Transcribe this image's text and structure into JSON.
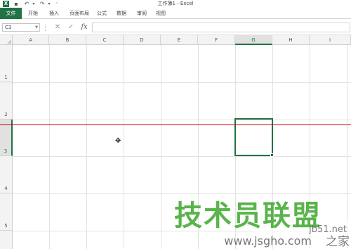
{
  "titlebar": {
    "title": "工作簿1 - Excel",
    "logo_letter": "X",
    "save_icon": "save-icon",
    "undo_icon": "undo-icon",
    "redo_icon": "redo-icon"
  },
  "ribbon": {
    "tabs": [
      "文件",
      "开始",
      "插入",
      "页面布局",
      "公式",
      "数据",
      "审阅",
      "视图"
    ]
  },
  "formula_bar": {
    "name_box": "C3",
    "cancel_icon": "✕",
    "enter_icon": "✓",
    "fx_label": "fx",
    "value": ""
  },
  "sheet": {
    "columns": [
      "A",
      "B",
      "C",
      "D",
      "E",
      "F",
      "G",
      "H",
      "I"
    ],
    "selected_column": "G",
    "rows": [
      "1",
      "2",
      "3",
      "4",
      "5"
    ],
    "selected_row": "3"
  },
  "watermark": {
    "brand": "技术员联盟",
    "site": "jb51.net",
    "site2": "www.jsgho.com",
    "home": "之家"
  },
  "colors": {
    "accent": "#217346",
    "guide_line": "#cc0000"
  }
}
